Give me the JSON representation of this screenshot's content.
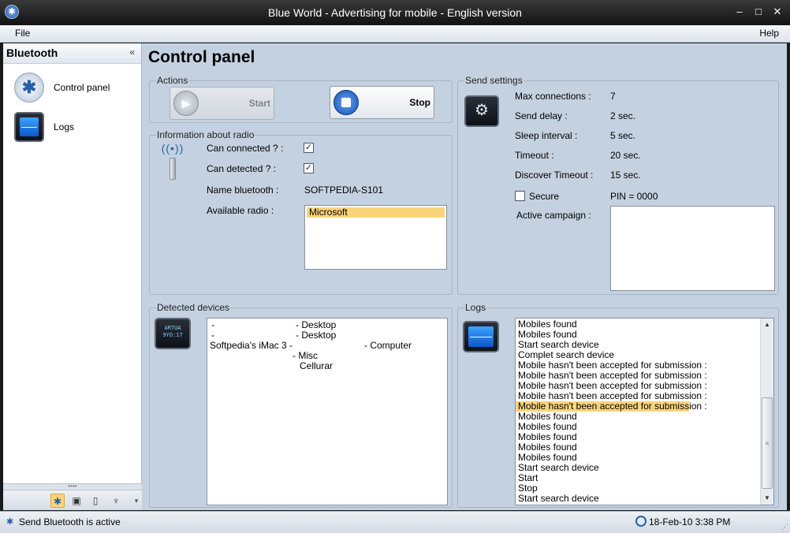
{
  "window": {
    "title": "Blue World - Advertising for mobile - English version",
    "buttons": {
      "minimize": "–",
      "maximize": "□",
      "close": "✕"
    },
    "app_icon": "bluetooth-icon"
  },
  "menu": {
    "file": "File",
    "help": "Help"
  },
  "sidebar": {
    "title": "Bluetooth",
    "collapse": "«",
    "items": [
      {
        "label": "Control panel",
        "icon": "bluetooth-icon"
      },
      {
        "label": "Logs",
        "icon": "monitor-pulse-icon"
      }
    ],
    "toolbar": [
      {
        "icon": "bluetooth-icon",
        "glyph": "✱",
        "active": true
      },
      {
        "icon": "logs-icon",
        "glyph": "▣"
      },
      {
        "icon": "device-icon",
        "glyph": "▯"
      },
      {
        "icon": "microphone-icon",
        "glyph": "♆"
      },
      {
        "icon": "more-icon",
        "glyph": "▾"
      }
    ],
    "grip": "••••"
  },
  "main": {
    "title": "Control panel",
    "actions": {
      "legend": "Actions",
      "start_label": "Start",
      "stop_label": "Stop"
    },
    "radio": {
      "legend": "Information about radio",
      "can_connected_label": "Can connected ? :",
      "can_connected": true,
      "can_detected_label": "Can detected ? :",
      "can_detected": true,
      "name_label": "Name bluetooth :",
      "name_value": "SOFTPEDIA-S101",
      "available_label": "Available radio :",
      "available": [
        "Microsoft"
      ]
    },
    "send_settings": {
      "legend": "Send settings",
      "max_connections_label": "Max connections :",
      "max_connections": "7",
      "send_delay_label": "Send delay :",
      "send_delay": "2 sec.",
      "sleep_interval_label": "Sleep interval :",
      "sleep_interval": "5 sec.",
      "timeout_label": "Timeout :",
      "timeout": "20 sec.",
      "discover_timeout_label": "Discover Timeout :",
      "discover_timeout": "15 sec.",
      "secure_label": "Secure",
      "secure": false,
      "pin": "PIN = 0000",
      "active_campaign_label": "Active campaign :"
    },
    "detected": {
      "legend": "Detected devices",
      "icon_text_1": "ARTUA",
      "icon_text_2": "9YO:17",
      "rows": [
        {
          "name": "-",
          "type": "- Desktop"
        },
        {
          "name": "-",
          "type": "- Desktop"
        },
        {
          "name": "Softpedia's iMac 3 -",
          "type": "- Computer"
        },
        {
          "name": "",
          "type": "- Misc"
        },
        {
          "name": "",
          "type": "Cellurar"
        }
      ]
    },
    "logs": {
      "legend": "Logs",
      "entries": [
        "Mobiles found",
        "Mobiles found",
        "Start search device",
        "Complet search device",
        "Mobile hasn't been accepted for submission :",
        "Mobile hasn't been accepted for submission :",
        "Mobile hasn't been accepted for submission :",
        "Mobile hasn't been accepted for submission :",
        "Mobile hasn't been accepted for submission :",
        "Mobiles found",
        "Mobiles found",
        "Mobiles found",
        "Mobiles found",
        "Mobiles found",
        "Start search device",
        "Start",
        "Stop",
        "Start search device"
      ],
      "selected_index": 8
    }
  },
  "status": {
    "text": "Send Bluetooth is active",
    "datetime": "18-Feb-10 3:38 PM"
  }
}
